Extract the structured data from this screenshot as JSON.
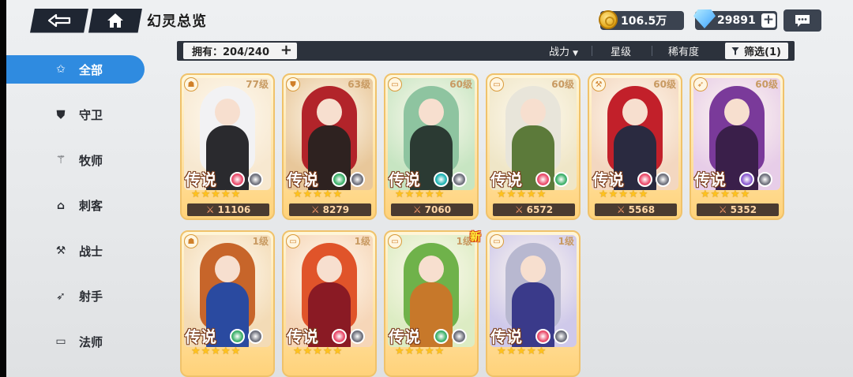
{
  "header": {
    "title": "幻灵总览",
    "gold": "106.5万",
    "gems": "29891"
  },
  "sidebar": {
    "items": [
      {
        "label": "全部",
        "icon": "star-outline-icon",
        "active": true
      },
      {
        "label": "守卫",
        "icon": "shield-icon",
        "active": false
      },
      {
        "label": "牧师",
        "icon": "priest-wings-icon",
        "active": false
      },
      {
        "label": "刺客",
        "icon": "assassin-icon",
        "active": false
      },
      {
        "label": "战士",
        "icon": "hammer-icon",
        "active": false
      },
      {
        "label": "射手",
        "icon": "bow-icon",
        "active": false
      },
      {
        "label": "法师",
        "icon": "book-icon",
        "active": false
      }
    ]
  },
  "filterbar": {
    "owned": "拥有：204/240",
    "sort_power": "战力",
    "sort_star": "星级",
    "sort_rarity": "稀有度",
    "filter": "筛选(1)"
  },
  "cards": [
    {
      "level": "77级",
      "rarity": "传说",
      "power": "11106",
      "stars": 5,
      "hair": "#f2f2f4",
      "outfit": "#2a2a2e",
      "bg": "#f7e8d0",
      "elements": [
        "#e94a6a",
        "#6d6f7b"
      ],
      "new": false
    },
    {
      "level": "63级",
      "rarity": "传说",
      "power": "8279",
      "stars": 5,
      "hair": "#b2242a",
      "outfit": "#2e2220",
      "bg": "#e8c79a",
      "elements": [
        "#3db06a",
        "#6d6f7b"
      ],
      "new": false
    },
    {
      "level": "60级",
      "rarity": "传说",
      "power": "7060",
      "stars": 5,
      "hair": "#8ec4a0",
      "outfit": "#2b3a33",
      "bg": "#c7e5c2",
      "elements": [
        "#1fb3b3",
        "#6d6f7b"
      ],
      "new": false
    },
    {
      "level": "60级",
      "rarity": "传说",
      "power": "6572",
      "stars": 5,
      "hair": "#e8e5da",
      "outfit": "#5c7a3a",
      "bg": "#efe6c7",
      "elements": [
        "#e94a6a",
        "#3db06a"
      ],
      "new": false
    },
    {
      "level": "60级",
      "rarity": "传说",
      "power": "5568",
      "stars": 5,
      "hair": "#c2202a",
      "outfit": "#2a2a40",
      "bg": "#f3d7c0",
      "elements": [
        "#e94a6a",
        "#6d6f7b"
      ],
      "new": false
    },
    {
      "level": "60级",
      "rarity": "传说",
      "power": "5352",
      "stars": 5,
      "hair": "#7a3a9a",
      "outfit": "#3a1f4a",
      "bg": "#e7cde8",
      "elements": [
        "#8a5ad0",
        "#6d6f7b"
      ],
      "new": false
    },
    {
      "level": "1级",
      "rarity": "传说",
      "power": "",
      "stars": 5,
      "hair": "#c7652a",
      "outfit": "#2a4aa0",
      "bg": "#f3dbb6",
      "elements": [
        "#3db06a",
        "#6d6f7b"
      ],
      "new": false
    },
    {
      "level": "1级",
      "rarity": "传说",
      "power": "",
      "stars": 5,
      "hair": "#e0542a",
      "outfit": "#8a1a24",
      "bg": "#f6d6b8",
      "elements": [
        "#e94a6a",
        "#6d6f7b"
      ],
      "new": false
    },
    {
      "level": "1级",
      "rarity": "传说",
      "power": "",
      "stars": 5,
      "hair": "#6fb24a",
      "outfit": "#c7782a",
      "bg": "#dcecc3",
      "elements": [
        "#3db06a",
        "#6d6f7b"
      ],
      "new": true,
      "new_label": "新"
    },
    {
      "level": "1级",
      "rarity": "传说",
      "power": "",
      "stars": 5,
      "hair": "#b8b8d0",
      "outfit": "#3a3a8a",
      "bg": "#cfc9ea",
      "elements": [
        "#e94a6a",
        "#6d6f7b"
      ],
      "new": false
    }
  ]
}
